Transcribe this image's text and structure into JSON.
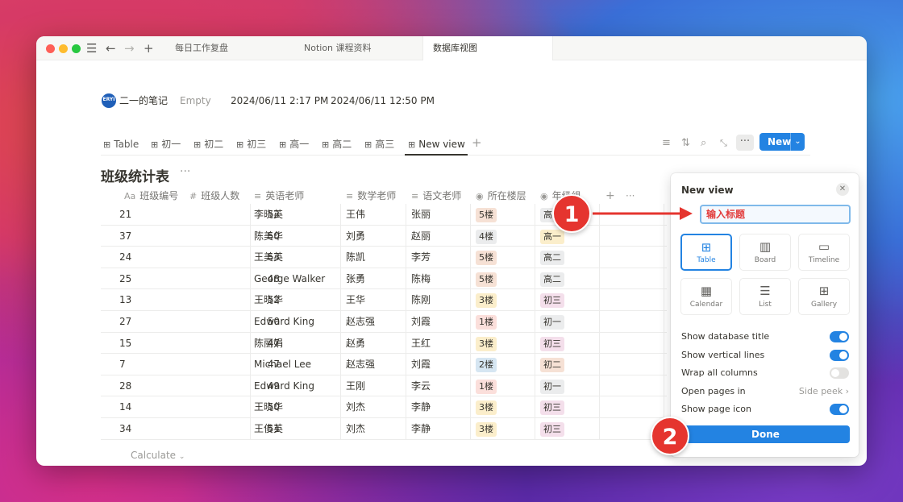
{
  "tabs": [
    {
      "label": "每日工作复盘"
    },
    {
      "label": "Notion 课程资料"
    },
    {
      "label": "数据库视图"
    }
  ],
  "page": {
    "owner": "二一的笔记",
    "avatar_text": "ERYI",
    "empty": "Empty",
    "created": "2024/06/11 2:17 PM",
    "edited": "2024/06/11 12:50 PM"
  },
  "views": [
    "Table",
    "初一",
    "初二",
    "初三",
    "高一",
    "高二",
    "高三",
    "New view"
  ],
  "toolbar": {
    "new_label": "New"
  },
  "database": {
    "title": "班级统计表",
    "columns": [
      {
        "label": "班级编号",
        "icon": "Aa"
      },
      {
        "label": "班级人数",
        "icon": "#"
      },
      {
        "label": "英语老师",
        "icon": "≡"
      },
      {
        "label": "数学老师",
        "icon": "≡"
      },
      {
        "label": "语文老师",
        "icon": "≡"
      },
      {
        "label": "所在楼层",
        "icon": "◉"
      },
      {
        "label": "年级组",
        "icon": "◉"
      }
    ],
    "rows": [
      {
        "id": "21",
        "count": "52",
        "en": "李晓英",
        "math": "王伟",
        "cn": "张丽",
        "floor": "5楼",
        "grade": "高二"
      },
      {
        "id": "37",
        "count": "50",
        "en": "陈美华",
        "math": "刘勇",
        "cn": "赵丽",
        "floor": "4楼",
        "grade": "高一"
      },
      {
        "id": "24",
        "count": "53",
        "en": "王美英",
        "math": "陈凯",
        "cn": "李芳",
        "floor": "5楼",
        "grade": "高二"
      },
      {
        "id": "25",
        "count": "48",
        "en": "George Walker",
        "math": "张勇",
        "cn": "陈梅",
        "floor": "5楼",
        "grade": "高二"
      },
      {
        "id": "13",
        "count": "52",
        "en": "王晓华",
        "math": "王华",
        "cn": "陈刚",
        "floor": "3楼",
        "grade": "初三"
      },
      {
        "id": "27",
        "count": "50",
        "en": "Edward King",
        "math": "赵志强",
        "cn": "刘霞",
        "floor": "1楼",
        "grade": "初一"
      },
      {
        "id": "15",
        "count": "47",
        "en": "陈丽娟",
        "math": "赵勇",
        "cn": "王红",
        "floor": "3楼",
        "grade": "初三"
      },
      {
        "id": "7",
        "count": "47",
        "en": "Michael Lee",
        "math": "赵志强",
        "cn": "刘霞",
        "floor": "2楼",
        "grade": "初二"
      },
      {
        "id": "28",
        "count": "49",
        "en": "Edward King",
        "math": "王刚",
        "cn": "李云",
        "floor": "1楼",
        "grade": "初一"
      },
      {
        "id": "14",
        "count": "50",
        "en": "王晓华",
        "math": "刘杰",
        "cn": "李静",
        "floor": "3楼",
        "grade": "初三"
      },
      {
        "id": "34",
        "count": "51",
        "en": "王俊英",
        "math": "刘杰",
        "cn": "李静",
        "floor": "3楼",
        "grade": "初三"
      }
    ],
    "calculate_label": "Calculate"
  },
  "panel": {
    "title": "New view",
    "name_value": "输入标题",
    "layouts": [
      "Table",
      "Board",
      "Timeline",
      "Calendar",
      "List",
      "Gallery"
    ],
    "options": [
      {
        "label": "Show database title",
        "on": true
      },
      {
        "label": "Show vertical lines",
        "on": true
      },
      {
        "label": "Wrap all columns",
        "on": false
      },
      {
        "label": "Open pages in",
        "value": "Side peek"
      },
      {
        "label": "Show page icon",
        "on": true
      }
    ],
    "done_label": "Done"
  },
  "annotations": [
    "1",
    "2"
  ],
  "colors": {
    "accent": "#2383e2",
    "annotation_red": "#e5352f",
    "floor_5": "#f6e1d5",
    "floor_4": "#ebeced",
    "floor_3": "#fbeecb",
    "floor_2": "#d6e6f2",
    "floor_1": "#fbdfdb",
    "grade_gao2": "#ebeced",
    "grade_gao1": "#fbeecb",
    "grade_chu3": "#f4dfeb",
    "grade_chu1": "#ebeced",
    "grade_chu2": "#f6e1d5"
  }
}
